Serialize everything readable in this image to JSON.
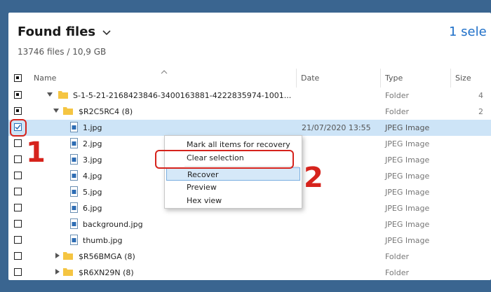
{
  "header": {
    "title": "Found files",
    "subtitle": "13746 files / 10,9 GB",
    "selected_count": "1 sele"
  },
  "columns": {
    "name": "Name",
    "date": "Date",
    "type": "Type",
    "size": "Size"
  },
  "rows": [
    {
      "name": "S-1-5-21-2168423846-3400163881-4222835974-1001...",
      "date": "",
      "type": "Folder",
      "size": "4"
    },
    {
      "name": "$R2C5RC4 (8)",
      "date": "",
      "type": "Folder",
      "size": "2"
    },
    {
      "name": "1.jpg",
      "date": "21/07/2020 13:55",
      "type": "JPEG Image",
      "size": ""
    },
    {
      "name": "2.jpg",
      "date": "",
      "type": "JPEG Image",
      "size": ""
    },
    {
      "name": "3.jpg",
      "date": "",
      "type": "JPEG Image",
      "size": ""
    },
    {
      "name": "4.jpg",
      "date": "",
      "type": "JPEG Image",
      "size": ""
    },
    {
      "name": "5.jpg",
      "date": "",
      "type": "JPEG Image",
      "size": ""
    },
    {
      "name": "6.jpg",
      "date": "",
      "type": "JPEG Image",
      "size": ""
    },
    {
      "name": "background.jpg",
      "date": "",
      "type": "JPEG Image",
      "size": ""
    },
    {
      "name": "thumb.jpg",
      "date": "",
      "type": "JPEG Image",
      "size": ""
    },
    {
      "name": "$R56BMGA (8)",
      "date": "",
      "type": "Folder",
      "size": ""
    },
    {
      "name": "$R6XN29N (8)",
      "date": "",
      "type": "Folder",
      "size": ""
    }
  ],
  "context_menu": {
    "mark_all": "Mark all items for recovery",
    "clear_selection": "Clear selection",
    "recover": "Recover",
    "preview": "Preview",
    "hex_view": "Hex view"
  },
  "annotations": {
    "step1": "1",
    "step2": "2"
  },
  "colors": {
    "accent": "#1e6fc8",
    "selection": "#cde4f7",
    "annotation": "#d6231c",
    "folder": "#f5c542"
  }
}
